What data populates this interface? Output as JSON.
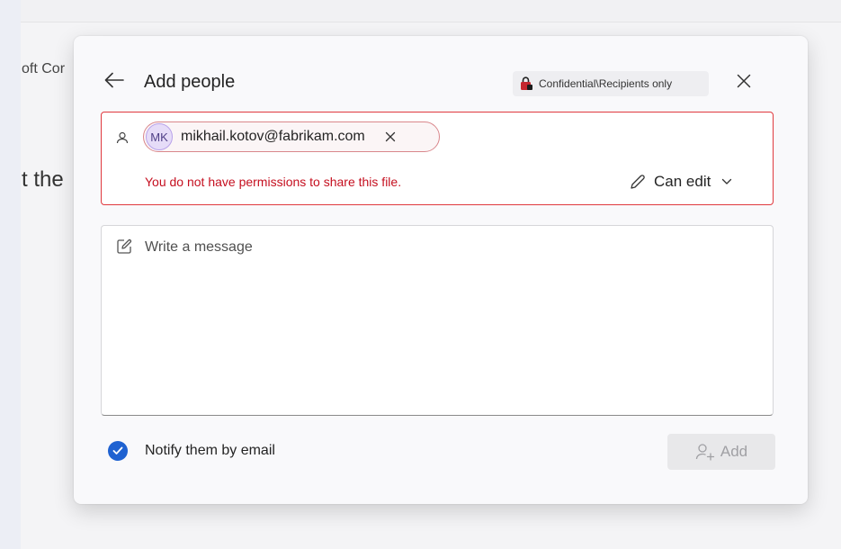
{
  "background": {
    "fragment_1": "oft Cor",
    "fragment_2": "t the"
  },
  "dialog": {
    "title": "Add people",
    "sensitivity_label": "Confidential\\Recipients only",
    "recipient": {
      "initials": "MK",
      "email": "mikhail.kotov@fabrikam.com"
    },
    "error_message": "You do not have permissions to share this file.",
    "permission": "Can edit",
    "message_placeholder": "Write a message",
    "notify_label": "Notify them by email",
    "notify_checked": true,
    "add_button": "Add"
  },
  "colors": {
    "error": "#c50f1f",
    "accent": "#1f62d1",
    "sensitivity_lock": "#c4262e"
  },
  "icons": [
    "back-arrow-icon",
    "lock-icon",
    "close-icon",
    "person-icon",
    "remove-icon",
    "pencil-icon",
    "chevron-down-icon",
    "compose-icon",
    "checkmark-icon",
    "add-person-icon"
  ]
}
